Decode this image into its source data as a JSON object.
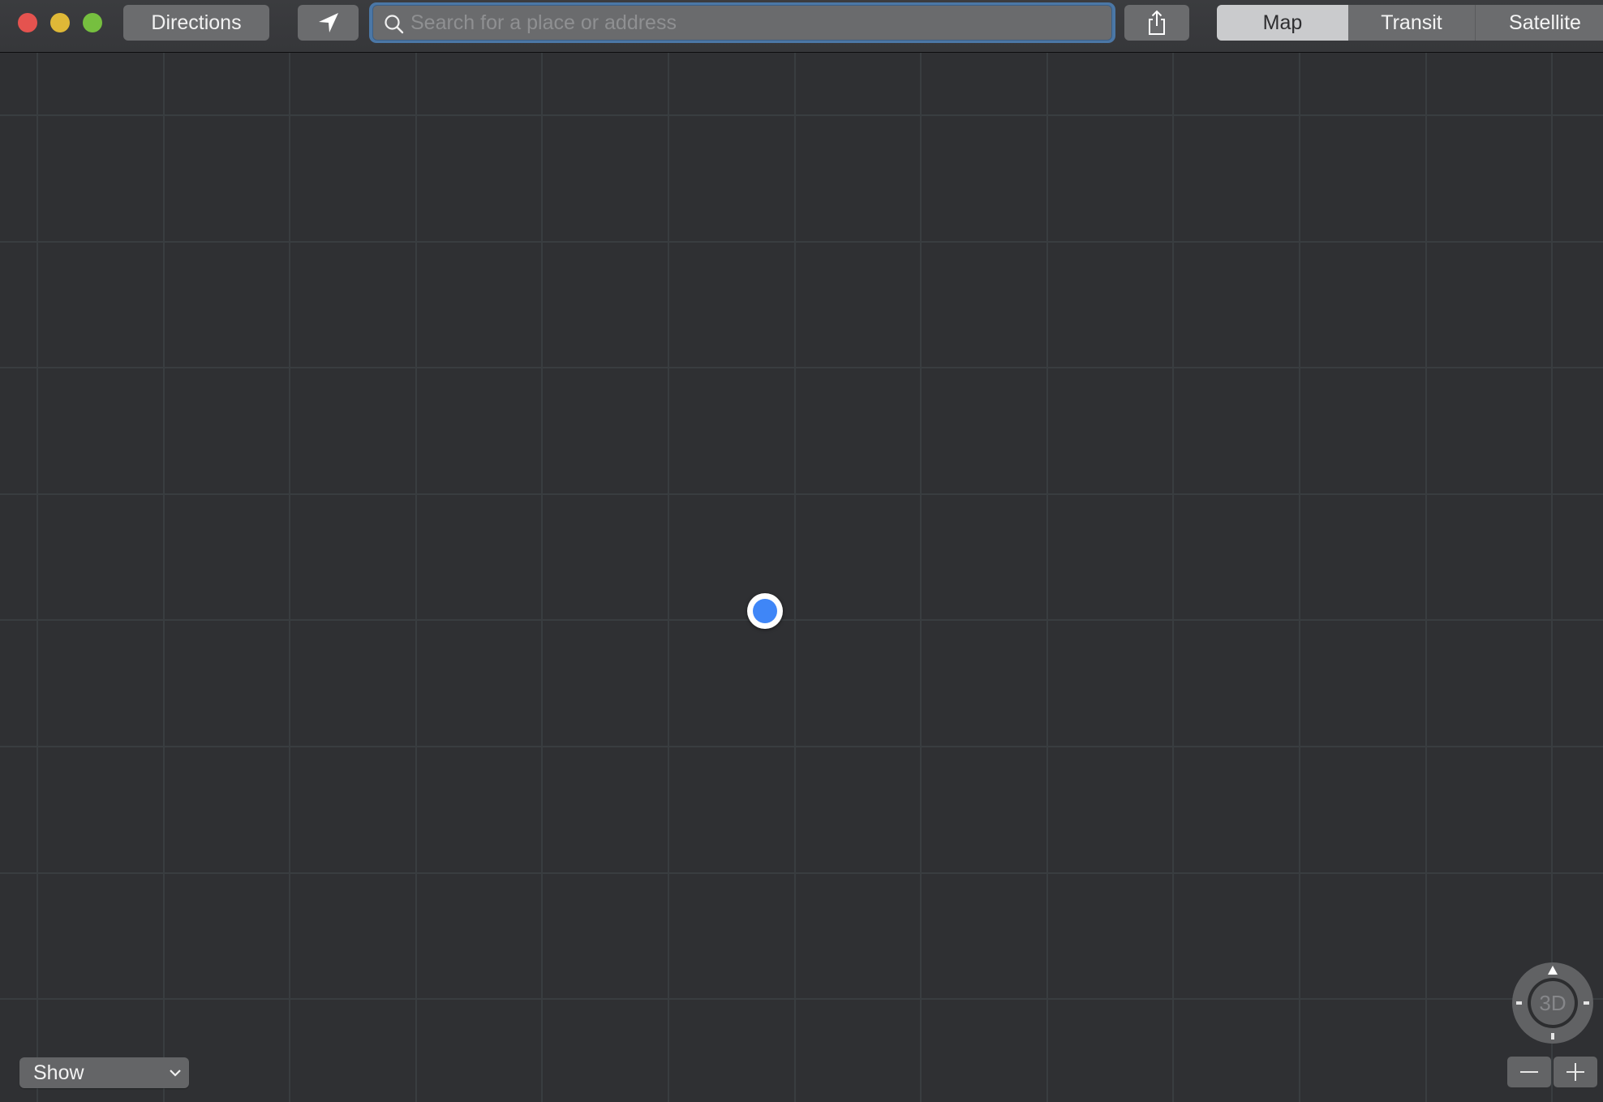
{
  "window": {
    "controls": [
      {
        "name": "close",
        "color": "#e5534f"
      },
      {
        "name": "minimize",
        "color": "#dfb837"
      },
      {
        "name": "zoom",
        "color": "#76bf3f"
      }
    ]
  },
  "toolbar": {
    "directions_label": "Directions",
    "current_location_icon": "location-arrow-icon",
    "search": {
      "placeholder": "Search for a place or address",
      "value": "",
      "icon": "search-icon",
      "focused": true
    },
    "share_icon": "share-icon",
    "map_modes": [
      {
        "label": "Map",
        "selected": true
      },
      {
        "label": "Transit",
        "selected": false
      },
      {
        "label": "Satellite",
        "selected": false
      }
    ]
  },
  "map": {
    "background": "#2f3033",
    "grid_color": "#393d40",
    "current_location": {
      "icon": "current-location-dot",
      "color": "#3f86f7"
    }
  },
  "controls": {
    "show_popup_label": "Show",
    "compass_label": "3D",
    "zoom_out_icon": "minus-icon",
    "zoom_in_icon": "plus-icon"
  }
}
